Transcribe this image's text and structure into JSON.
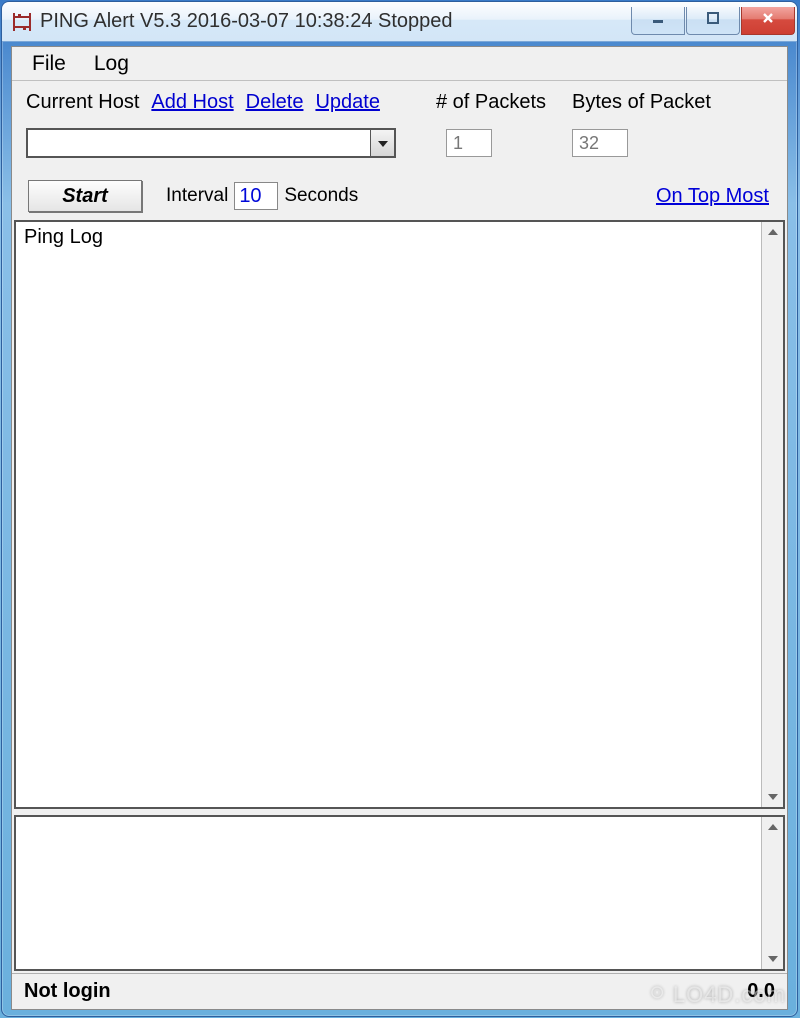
{
  "window": {
    "title": "PING Alert V5.3 2016-03-07 10:38:24 Stopped"
  },
  "menubar": {
    "file": "File",
    "log": "Log"
  },
  "labels": {
    "current_host": "Current Host",
    "packets": "# of Packets",
    "bytes": "Bytes of Packet",
    "interval": "Interval",
    "seconds": "Seconds"
  },
  "links": {
    "add_host": "Add Host",
    "delete": "Delete",
    "update": "Update",
    "on_top": "On Top Most"
  },
  "fields": {
    "host": "",
    "packets": "1",
    "bytes": "32",
    "interval": "10"
  },
  "buttons": {
    "start": "Start"
  },
  "log": {
    "title": "Ping Log"
  },
  "status": {
    "left": "Not login",
    "right": "0.0"
  },
  "watermark": "LO4D.com"
}
